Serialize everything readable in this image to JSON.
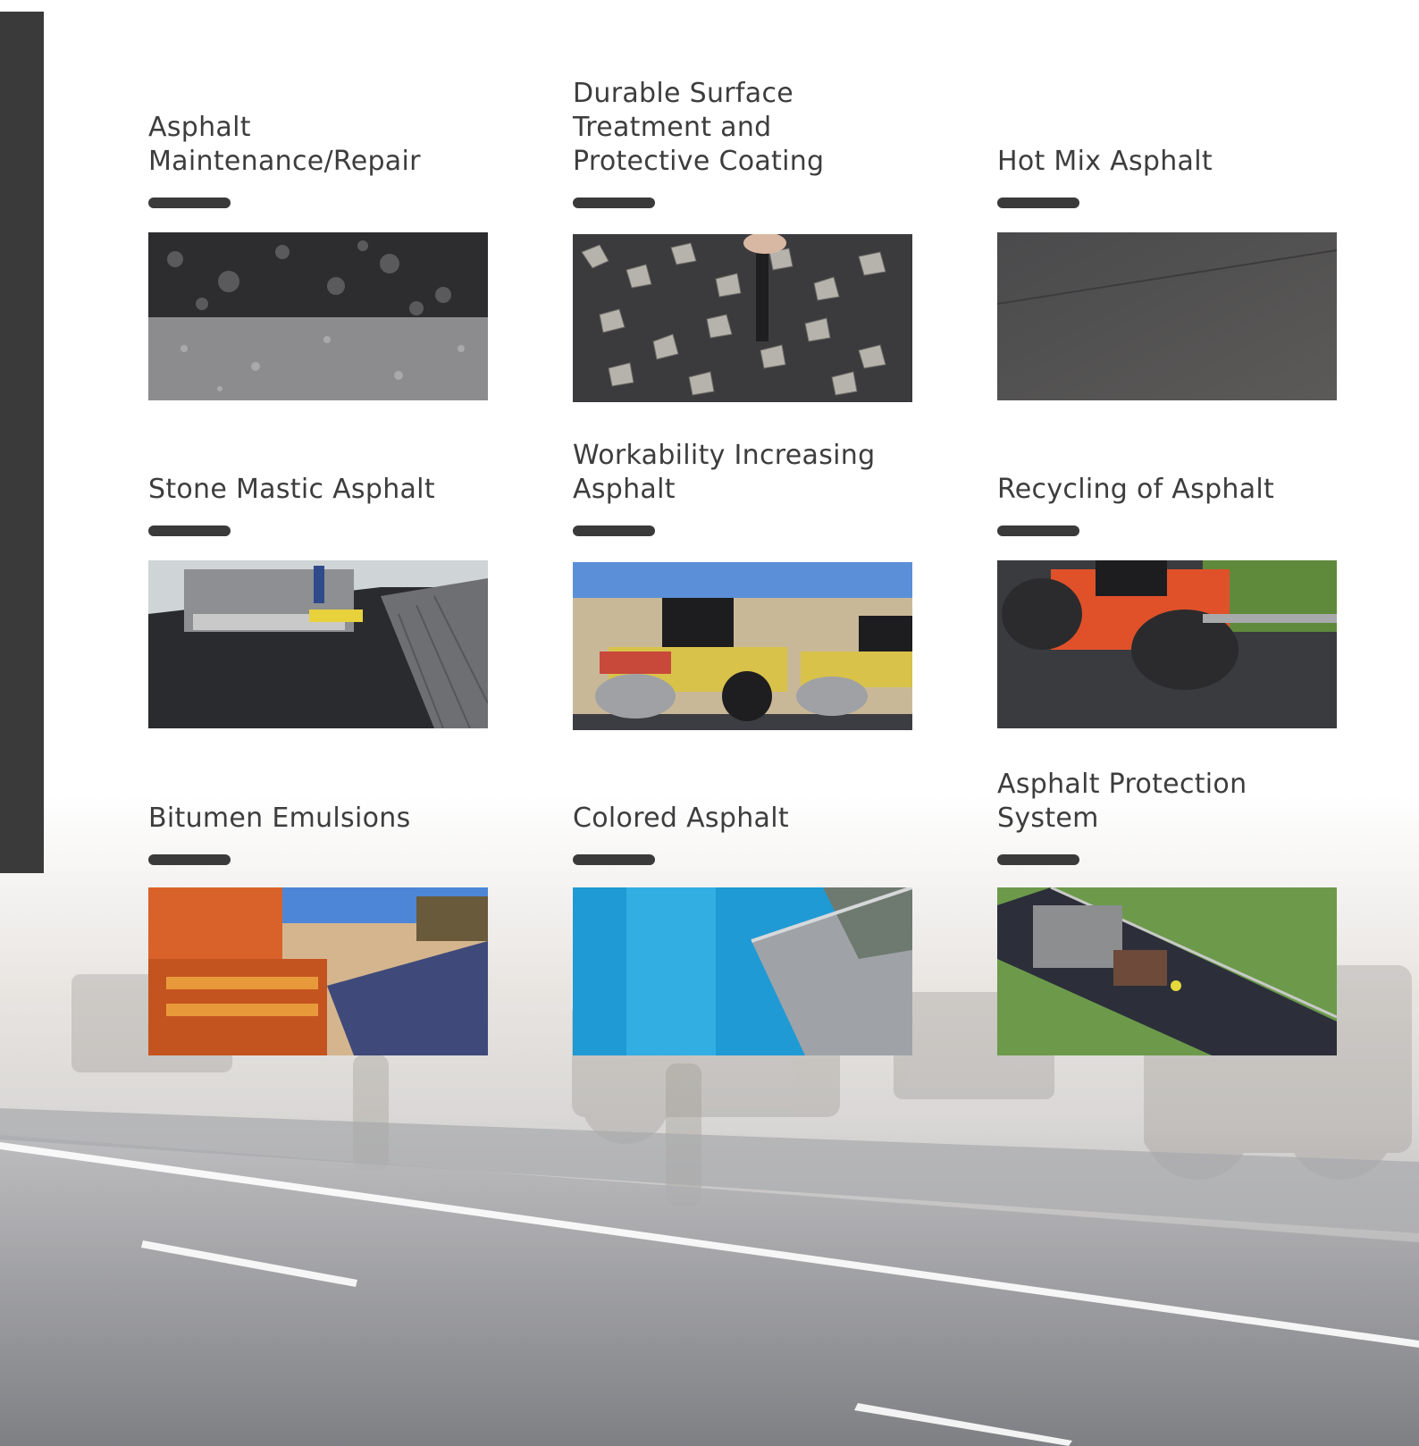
{
  "colors": {
    "accent_bar": "#3a3a3a",
    "title_text": "#3d3d3d"
  },
  "cards": [
    {
      "title": "Asphalt Maintenance/Repair",
      "photo": "asphalt-surface-closeup"
    },
    {
      "title": "Durable Surface Treatment and Protective Coating",
      "photo": "gravel-chip-seal"
    },
    {
      "title": "Hot Mix Asphalt",
      "photo": "fresh-asphalt-surface"
    },
    {
      "title": "Stone Mastic Asphalt",
      "photo": "paver-laying-asphalt"
    },
    {
      "title": "Workability Increasing Asphalt",
      "photo": "road-rollers"
    },
    {
      "title": "Recycling of Asphalt",
      "photo": "orange-road-roller"
    },
    {
      "title": "Bitumen Emulsions",
      "photo": "emulsion-sprayer"
    },
    {
      "title": "Colored Asphalt",
      "photo": "blue-pigment-pouring"
    },
    {
      "title": "Asphalt Protection System",
      "photo": "truck-on-highway"
    }
  ]
}
